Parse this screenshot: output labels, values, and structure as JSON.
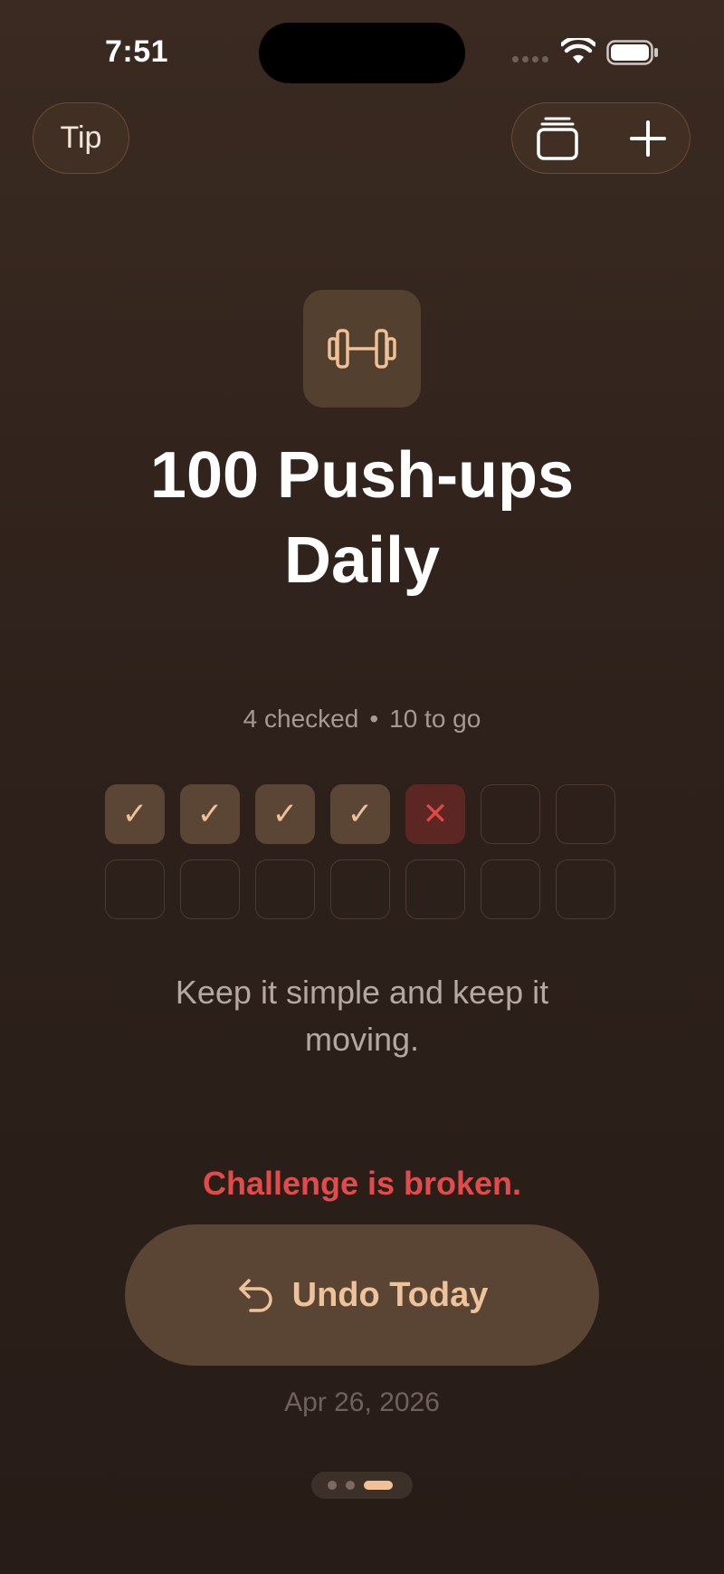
{
  "status_bar": {
    "time": "7:51"
  },
  "top_bar": {
    "tip_label": "Tip",
    "icons": [
      "cards-stack-icon",
      "plus-icon"
    ]
  },
  "challenge": {
    "icon": "dumbbell-icon",
    "title": "100 Push-ups Daily",
    "checked_text": "4 checked",
    "separator": "•",
    "remaining_text": "10 to go",
    "motto": "Keep it simple and keep it moving.",
    "status": "Challenge is broken.",
    "undo_label": "Undo Today",
    "date": "Apr 26, 2026"
  },
  "days": [
    {
      "state": "checked",
      "mark": "✓"
    },
    {
      "state": "checked",
      "mark": "✓"
    },
    {
      "state": "checked",
      "mark": "✓"
    },
    {
      "state": "checked",
      "mark": "✓"
    },
    {
      "state": "missed",
      "mark": "✕"
    },
    {
      "state": "empty",
      "mark": ""
    },
    {
      "state": "empty",
      "mark": ""
    },
    {
      "state": "empty",
      "mark": ""
    },
    {
      "state": "empty",
      "mark": ""
    },
    {
      "state": "empty",
      "mark": ""
    },
    {
      "state": "empty",
      "mark": ""
    },
    {
      "state": "empty",
      "mark": ""
    },
    {
      "state": "empty",
      "mark": ""
    },
    {
      "state": "empty",
      "mark": ""
    }
  ],
  "pagination": {
    "count": 3,
    "active_index": 2
  },
  "colors": {
    "accent": "#f0c196",
    "danger": "#e34b4b",
    "background": "#2e211b"
  }
}
